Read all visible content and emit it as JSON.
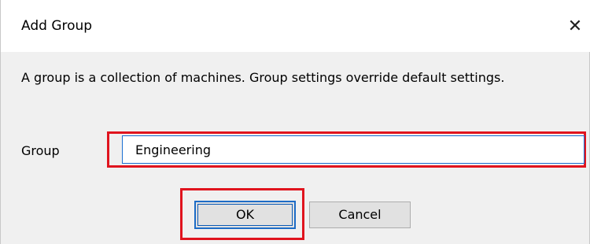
{
  "window": {
    "title": "Add Group",
    "close_glyph": "✕"
  },
  "description": "A group is a collection of machines.  Group settings override default settings.",
  "form": {
    "group_label": "Group",
    "group_value": "Engineering"
  },
  "buttons": {
    "ok_label": "OK",
    "cancel_label": "Cancel"
  },
  "colors": {
    "highlight": "#e0141e",
    "focus_blue": "#1a6fd2",
    "dialog_bg": "#f0f0f0"
  }
}
